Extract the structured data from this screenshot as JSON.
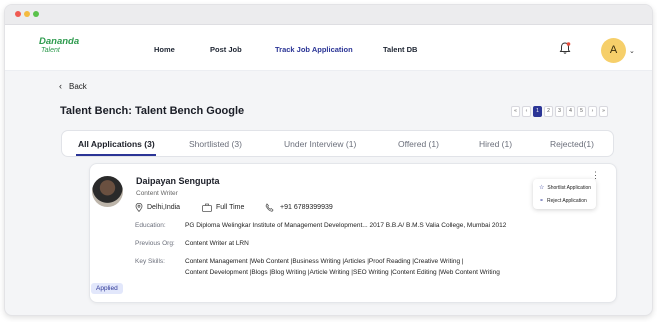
{
  "brand": {
    "line1": "Dananda",
    "line2": "Talent"
  },
  "nav": {
    "items": [
      {
        "label": "Home"
      },
      {
        "label": "Post Job"
      },
      {
        "label": "Track Job Application"
      },
      {
        "label": "Talent DB"
      }
    ],
    "user_initial": "A"
  },
  "back_label": "Back",
  "page_title": "Talent Bench: Talent Bench Google",
  "pagination": {
    "first": "«",
    "prev": "‹",
    "pages": [
      "1",
      "2",
      "3",
      "4",
      "5"
    ],
    "current": "1",
    "next": "›",
    "last": "»"
  },
  "tabs": [
    {
      "label": "All Applications (3)"
    },
    {
      "label": "Shortlisted (3)"
    },
    {
      "label": "Under Interview (1)"
    },
    {
      "label": "Offered (1)"
    },
    {
      "label": "Hired (1)"
    },
    {
      "label": "Rejected(1)"
    }
  ],
  "candidate": {
    "name": "Daipayan Sengupta",
    "role": "Content Writer",
    "location": "Delhi,India",
    "job_type": "Full Time",
    "phone": "+91 6789399939",
    "education_label": "Education:",
    "education": "PG Diploma Welingkar Institute of Management Development... 2017 B.B.A/ B.M.S Valia College, Mumbai 2012",
    "previous_org_label": "Previous Org:",
    "previous_org": "Content Writer at LRN",
    "key_skills_label": "Key Skills:",
    "key_skills_line1": "Content Management |Web Content |Business Writing |Articles |Proof Reading |Creative Writing |",
    "key_skills_line2": "Content Development |Blogs |Blog Writing |Article Writing |SEO Writing |Content Editing |Web Content Writing",
    "status": "Applied"
  },
  "actions_menu": {
    "shortlist": "Shortlist Application",
    "reject": "Reject Application"
  },
  "colors": {
    "accent": "#2b3596",
    "brand_green": "#2e9b4e",
    "avatar_bg": "#f6cf6a",
    "badge_bg": "#e2e7fb"
  }
}
